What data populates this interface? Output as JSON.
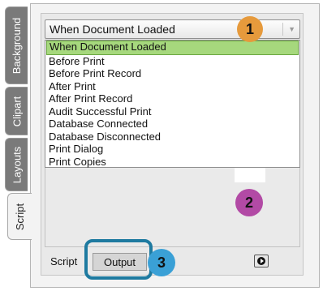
{
  "side_tabs": [
    {
      "label": "Background"
    },
    {
      "label": "Clipart"
    },
    {
      "label": "Layouts"
    },
    {
      "label": "Script"
    }
  ],
  "event_dropdown": {
    "selected": "When Document Loaded"
  },
  "event_list": [
    "When Document Loaded",
    "Before Print",
    "Before Print Record",
    "After Print",
    "After Print Record",
    "Audit Successful Print",
    "Database Connected",
    "Database Disconnected",
    "Print Dialog",
    "Print Copies"
  ],
  "bottom_tabs": {
    "script": "Script",
    "output": "Output"
  },
  "callouts": {
    "one": "1",
    "two": "2",
    "three": "3"
  },
  "colors": {
    "selection": "#a6d87d",
    "callout1": "#e69a3c",
    "callout2": "#b24aa5",
    "callout3": "#3aa0d6",
    "highlight_border": "#1e7aa0"
  }
}
